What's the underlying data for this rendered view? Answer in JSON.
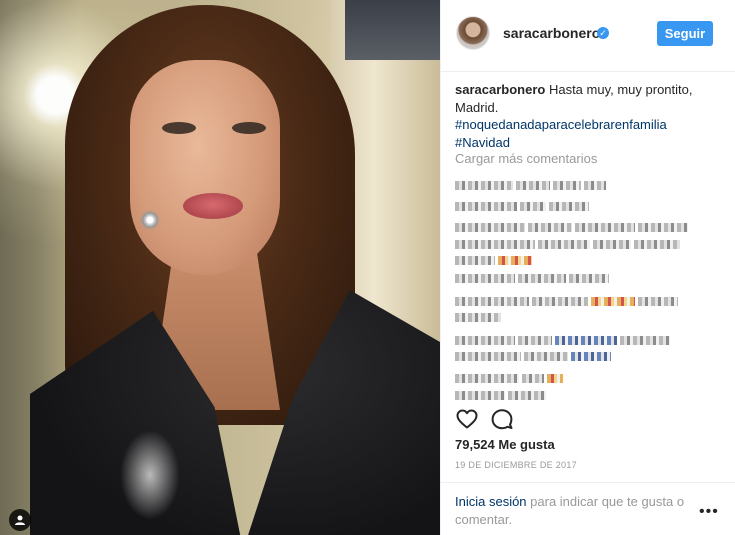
{
  "post": {
    "photo_alt": "",
    "user_tag_icon": "user-tag-icon"
  },
  "header": {
    "username": "saracarbonero",
    "verified_icon": "verified-badge-icon",
    "follow_label": "Seguir"
  },
  "caption": {
    "username": "saracarbonero",
    "text": "Hasta muy, muy prontito, Madrid.",
    "hashtags": [
      "#noquedanadaparacelebrarenfamilia",
      "#Navidad"
    ]
  },
  "comments": {
    "load_more_label": "Cargar más comentarios"
  },
  "actions": {
    "like_icon": "heart-icon",
    "comment_icon": "comment-icon"
  },
  "likes": "79,524 Me gusta",
  "date": "19 DE DICIEMBRE DE 2017",
  "footer": {
    "login_link": "Inicia sesión",
    "login_text": " para indicar que te gusta o comentar.",
    "more_label": "•••"
  },
  "colors": {
    "accent": "#3897f0",
    "link": "#003569",
    "muted": "#999999"
  }
}
